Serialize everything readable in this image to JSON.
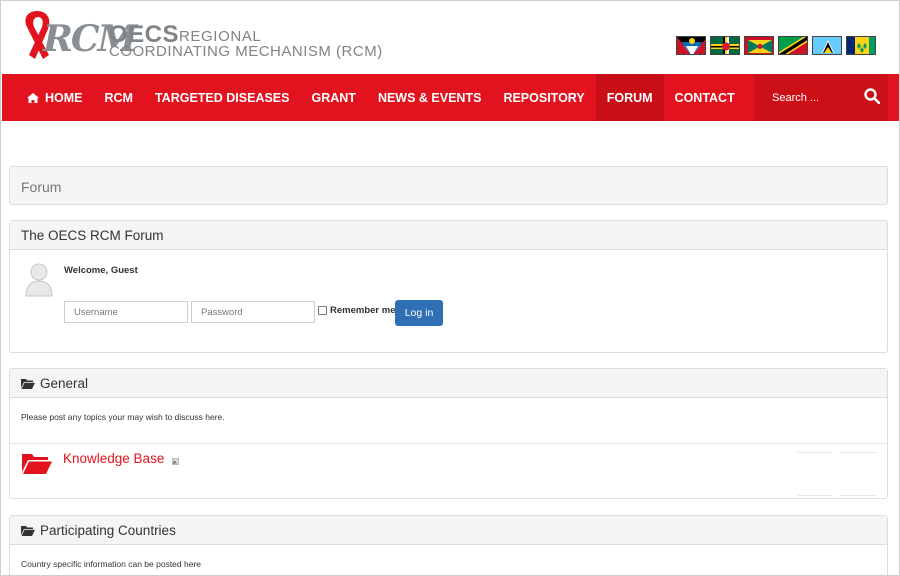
{
  "header": {
    "logo": {
      "rcm": "RCM",
      "oecs": "OECS",
      "regional": "REGIONAL",
      "coordinating": "COORDINATING MECHANISM (RCM)"
    },
    "flag_icons": [
      "antigua-barbuda-flag-icon",
      "dominica-flag-icon",
      "grenada-flag-icon",
      "st-kitts-nevis-flag-icon",
      "st-lucia-flag-icon",
      "st-vincent-flag-icon"
    ]
  },
  "nav": {
    "items": [
      {
        "label": "HOME",
        "icon": "home-icon"
      },
      {
        "label": "RCM"
      },
      {
        "label": "TARGETED DISEASES"
      },
      {
        "label": "GRANT"
      },
      {
        "label": "NEWS & EVENTS"
      },
      {
        "label": "REPOSITORY"
      },
      {
        "label": "FORUM",
        "active": true
      },
      {
        "label": "CONTACT"
      }
    ],
    "search_placeholder": "Search ...",
    "search_icon": "search-icon"
  },
  "colors": {
    "brand_red": "#e2131e",
    "active_red": "#c80f18",
    "button_blue": "#2f6fb3"
  },
  "breadcrumb": "Forum",
  "login_panel": {
    "title": "The OECS RCM Forum",
    "welcome": "Welcome, Guest",
    "username_placeholder": "Username",
    "password_placeholder": "Password",
    "remember_label": "Remember me",
    "login_button": "Log in"
  },
  "sections": [
    {
      "title": "General",
      "description": "Please post any topics your may wish to discuss here.",
      "categories": [
        {
          "title": "Knowledge Base"
        }
      ]
    },
    {
      "title": "Participating Countries",
      "description": "Country specific information can be posted here"
    }
  ]
}
